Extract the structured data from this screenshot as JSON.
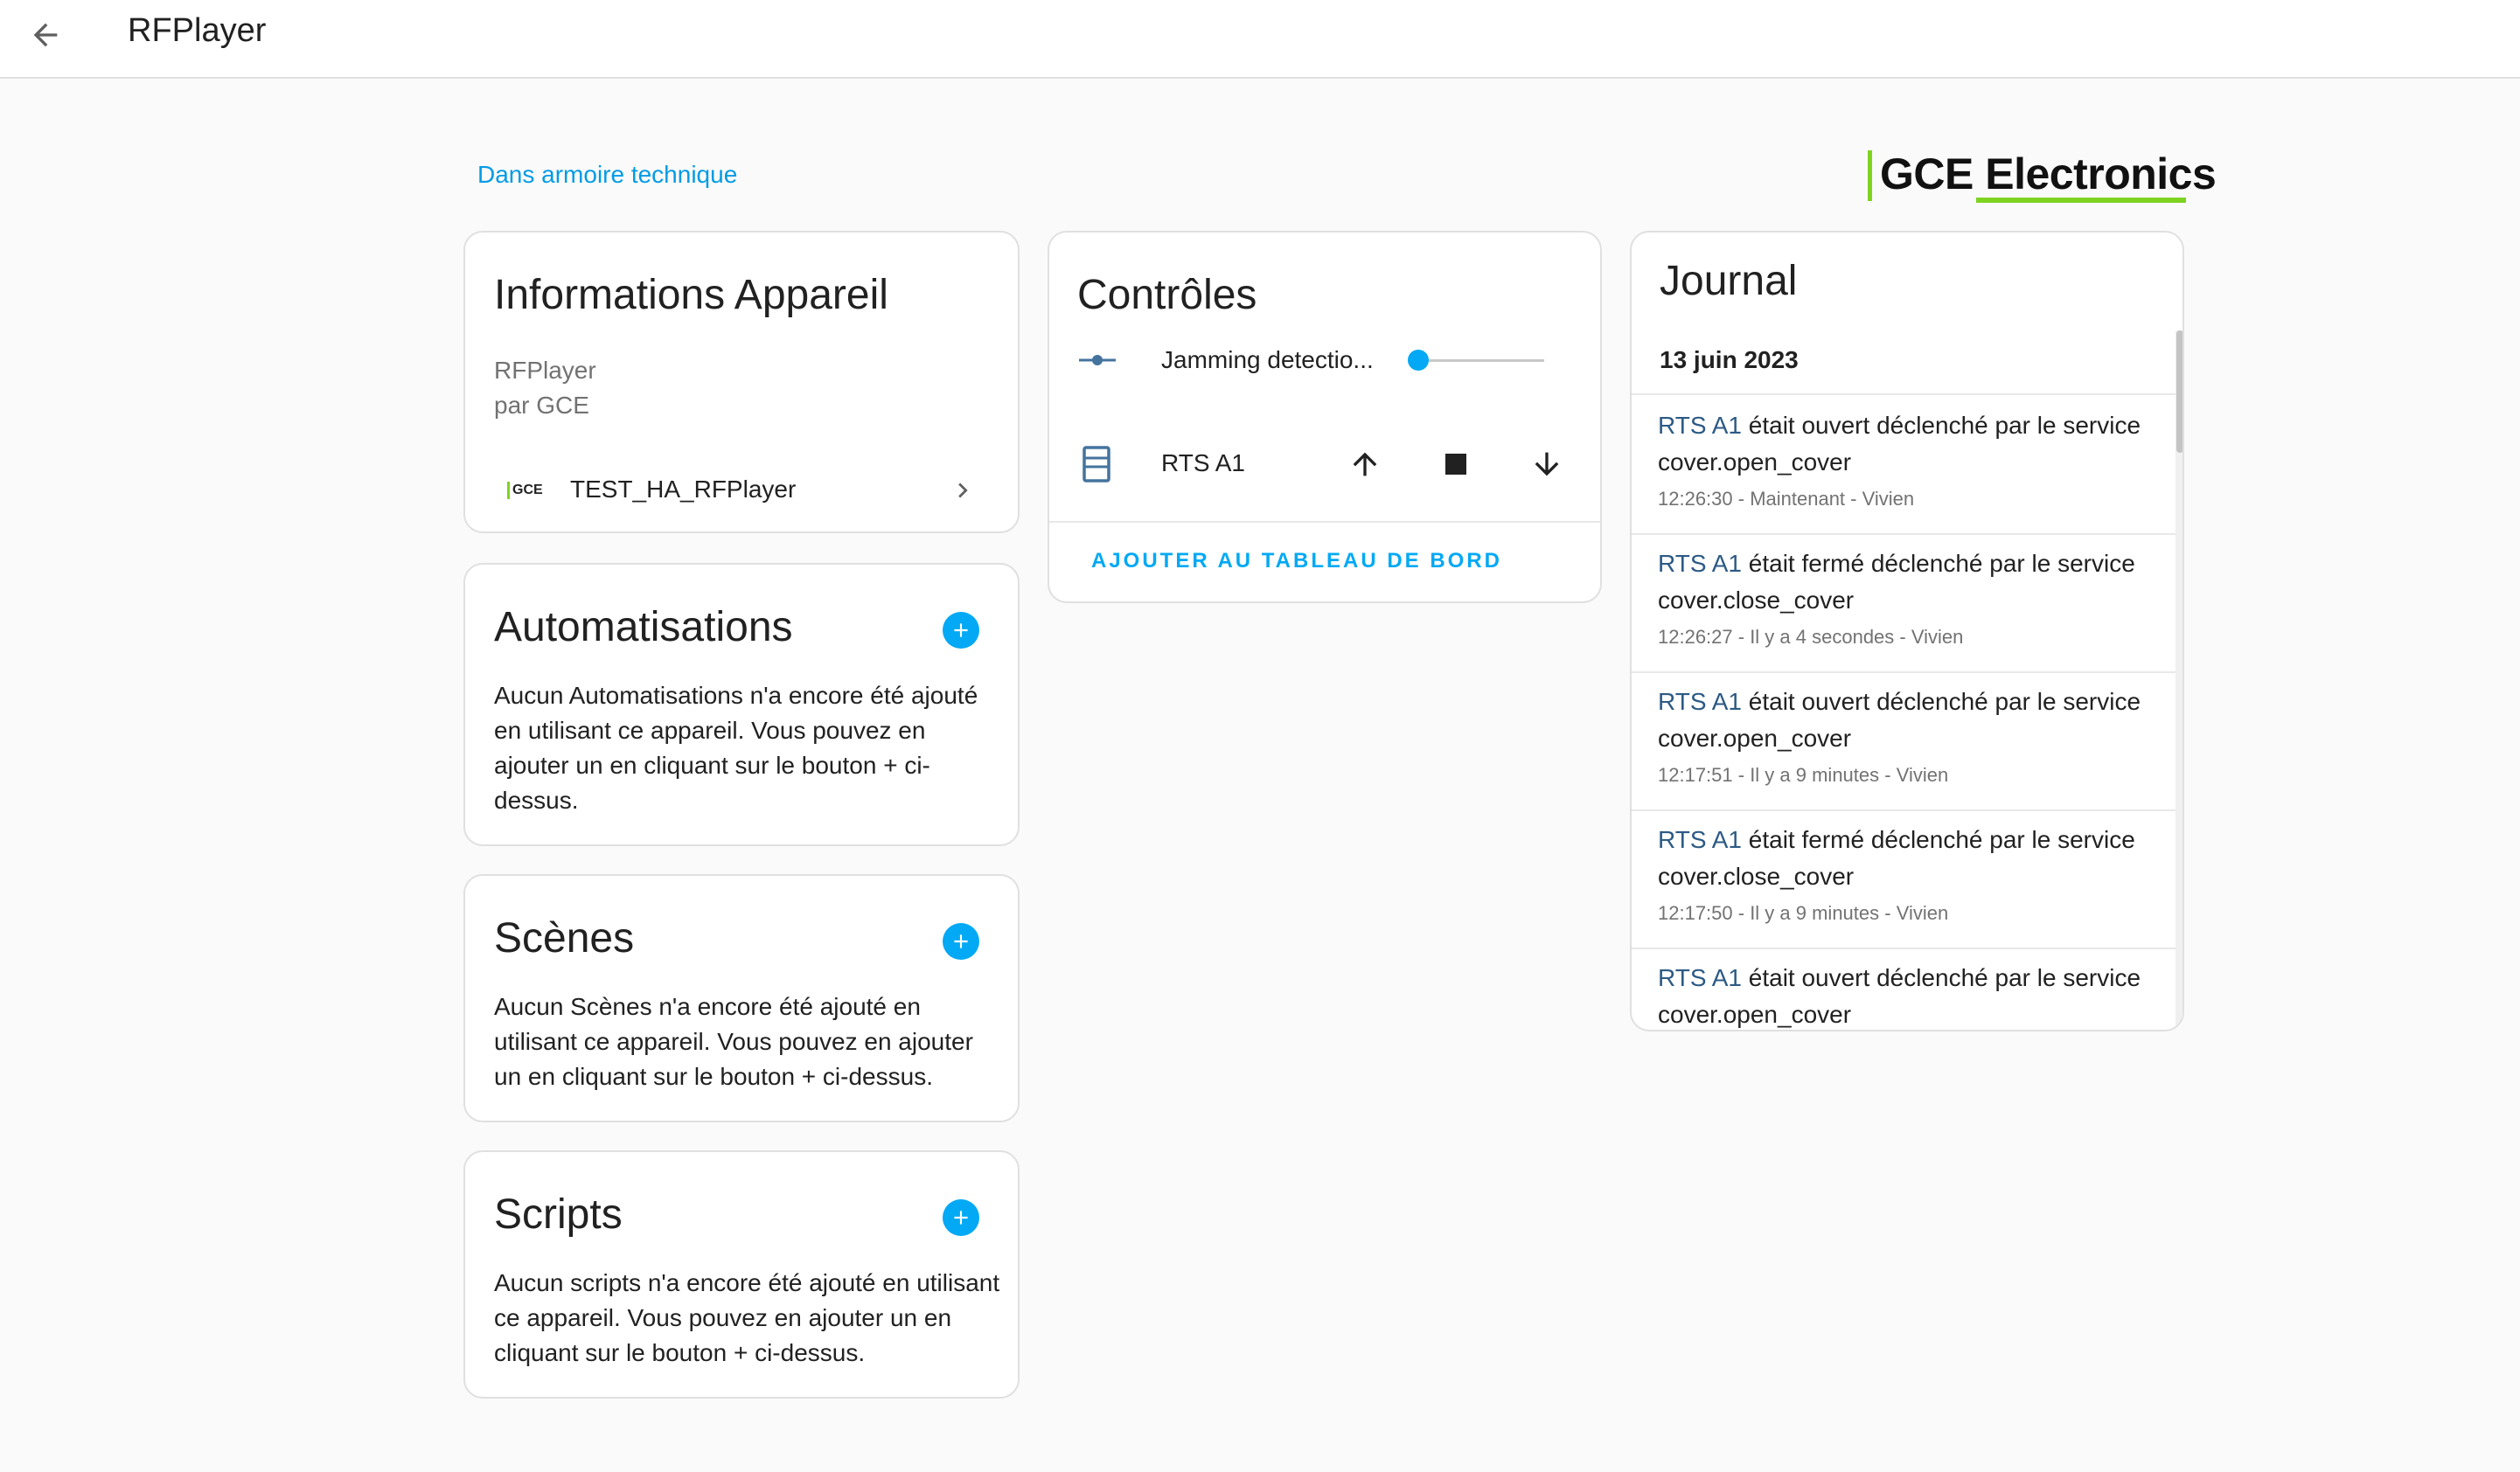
{
  "header": {
    "title": "RFPlayer"
  },
  "area_link": "Dans armoire technique",
  "brand": {
    "text": "GCE Electronics",
    "accent": "#7ed321"
  },
  "info_card": {
    "title": "Informations Appareil",
    "model": "RFPlayer",
    "manufacturer": "par GCE",
    "integration_badge": "GCE",
    "integration_entry": "TEST_HA_RFPlayer"
  },
  "automations_card": {
    "title": "Automatisations",
    "text": "Aucun Automatisations n'a encore été ajouté en utilisant ce appareil. Vous pouvez en ajouter un en cliquant sur le bouton + ci-dessus."
  },
  "scenes_card": {
    "title": "Scènes",
    "text": "Aucun Scènes n'a encore été ajouté en utilisant ce appareil. Vous pouvez en ajouter un en cliquant sur le bouton + ci-dessus."
  },
  "scripts_card": {
    "title": "Scripts",
    "text": "Aucun scripts n'a encore été ajouté en utilisant ce appareil. Vous pouvez en ajouter un en cliquant sur le bouton + ci-dessus."
  },
  "controls_card": {
    "title": "Contrôles",
    "jamming_label": "Jamming detectio...",
    "jamming_value": 0,
    "cover_label": "RTS A1",
    "add_dashboard": "AJOUTER AU TABLEAU DE BORD"
  },
  "journal_card": {
    "title": "Journal",
    "date": "13 juin 2023",
    "entries": [
      {
        "entity": "RTS A1",
        "action": " était ouvert déclenché par le service",
        "service": "cover.open_cover",
        "meta": "12:26:30 - Maintenant - Vivien"
      },
      {
        "entity": "RTS A1",
        "action": " était fermé déclenché par le service",
        "service": "cover.close_cover",
        "meta": "12:26:27 - Il y a 4 secondes - Vivien"
      },
      {
        "entity": "RTS A1",
        "action": " était ouvert déclenché par le service",
        "service": "cover.open_cover",
        "meta": "12:17:51 - Il y a 9 minutes - Vivien"
      },
      {
        "entity": "RTS A1",
        "action": " était fermé déclenché par le service",
        "service": "cover.close_cover",
        "meta": "12:17:50 - Il y a 9 minutes - Vivien"
      },
      {
        "entity": "RTS A1",
        "action": " était ouvert déclenché par le service",
        "service": "cover.open_cover",
        "meta": ""
      }
    ]
  },
  "colors": {
    "primary": "#03a9f4",
    "link": "#039be5",
    "icon": "#44739e"
  }
}
